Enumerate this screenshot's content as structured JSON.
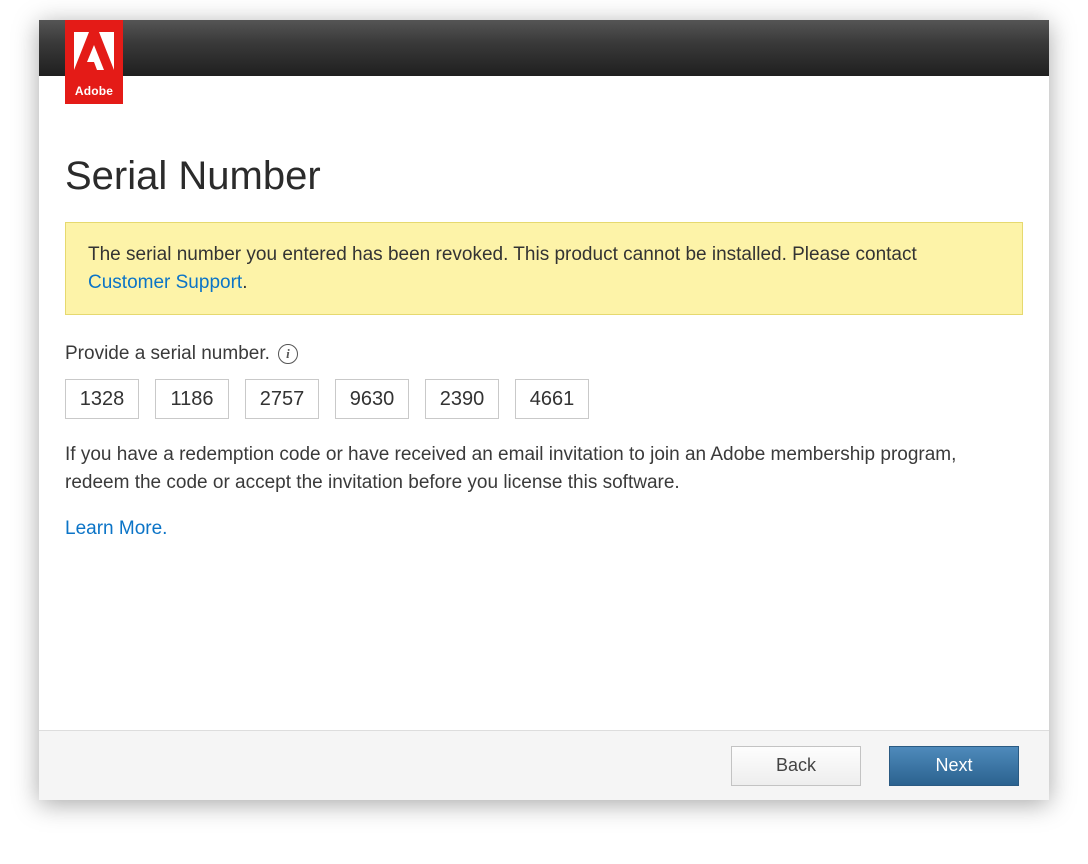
{
  "brand": {
    "name": "Adobe"
  },
  "page": {
    "title": "Serial Number"
  },
  "alert": {
    "message_part1": "The serial number you entered has been revoked. This product cannot be installed. Please contact ",
    "support_link_text": "Customer Support",
    "message_part2": "."
  },
  "serial": {
    "prompt": "Provide a serial number.",
    "fields": [
      "1328",
      "1186",
      "2757",
      "9630",
      "2390",
      "4661"
    ],
    "redeem_text": "If you have a redemption code or have received an email invitation to join an Adobe membership program, redeem the code or accept the invitation before you license this software.",
    "learn_more": "Learn More."
  },
  "footer": {
    "back": "Back",
    "next": "Next"
  }
}
